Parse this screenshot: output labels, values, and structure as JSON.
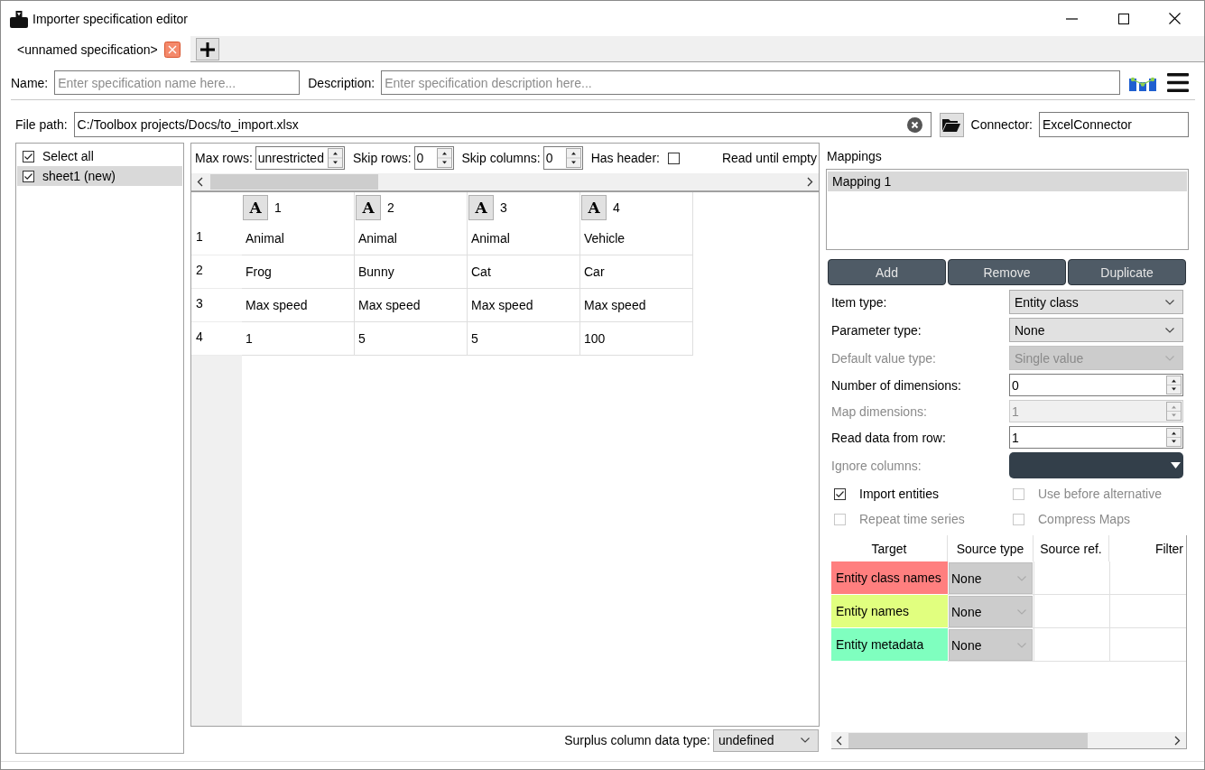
{
  "window": {
    "title": "Importer specification editor"
  },
  "tabs": [
    {
      "label": "<unnamed specification>",
      "selected": true
    }
  ],
  "name_field": {
    "label": "Name:",
    "placeholder": "Enter specification name here..."
  },
  "description_field": {
    "label": "Description:",
    "placeholder": "Enter specification description here..."
  },
  "file_path": {
    "label": "File path:",
    "value": "C:/Toolbox projects/Docs/to_import.xlsx"
  },
  "connector": {
    "label": "Connector:",
    "value": "ExcelConnector"
  },
  "sheets": [
    {
      "label": "Select all",
      "checked": true,
      "selected": false
    },
    {
      "label": "sheet1 (new)",
      "checked": true,
      "selected": true
    }
  ],
  "source_options": [
    {
      "kind": "spin",
      "label": "Max rows:",
      "value": "unrestricted"
    },
    {
      "kind": "spin",
      "label": "Skip rows:",
      "value": "0"
    },
    {
      "kind": "spin",
      "label": "Skip columns:",
      "value": "0"
    },
    {
      "kind": "check",
      "label": "Has header:",
      "checked": false
    },
    {
      "kind": "label",
      "label": "Read until empty"
    }
  ],
  "preview_table": {
    "columns": [
      {
        "type": "A",
        "label": "1"
      },
      {
        "type": "A",
        "label": "2"
      },
      {
        "type": "A",
        "label": "3"
      },
      {
        "type": "A",
        "label": "4"
      }
    ],
    "rows": [
      {
        "header": "1",
        "cells": [
          "Animal",
          "Animal",
          "Animal",
          "Vehicle"
        ]
      },
      {
        "header": "2",
        "cells": [
          "Frog",
          "Bunny",
          "Cat",
          "Car"
        ]
      },
      {
        "header": "3",
        "cells": [
          "Max speed",
          "Max speed",
          "Max speed",
          "Max speed"
        ]
      },
      {
        "header": "4",
        "cells": [
          "1",
          "5",
          "5",
          "100"
        ]
      }
    ]
  },
  "surplus_column_data_type": {
    "label": "Surplus column data type:",
    "value": "undefined"
  },
  "mappings": {
    "title": "Mappings",
    "items": [
      {
        "label": "Mapping 1",
        "selected": true
      }
    ],
    "buttons": [
      "Add",
      "Remove",
      "Duplicate"
    ]
  },
  "mapping_options": [
    {
      "kind": "combo",
      "label": "Item type:",
      "value": "Entity class",
      "disabled": false
    },
    {
      "kind": "combo",
      "label": "Parameter type:",
      "value": "None",
      "disabled": false
    },
    {
      "kind": "combo",
      "label": "Default value type:",
      "value": "Single value",
      "disabled": true
    },
    {
      "kind": "spin",
      "label": "Number of dimensions:",
      "value": "0",
      "disabled": false
    },
    {
      "kind": "spin",
      "label": "Map dimensions:",
      "value": "1",
      "disabled": true
    },
    {
      "kind": "spin",
      "label": "Read data from row:",
      "value": "1",
      "disabled": false
    },
    {
      "kind": "multi",
      "label": "Ignore columns:",
      "disabled": true
    }
  ],
  "mapping_checks": [
    {
      "label": "Import entities",
      "checked": true,
      "disabled": false
    },
    {
      "label": "Use before alternative",
      "checked": false,
      "disabled": true
    },
    {
      "label": "Repeat time series",
      "checked": false,
      "disabled": true
    },
    {
      "label": "Compress Maps",
      "checked": false,
      "disabled": true
    }
  ],
  "mapping_table": {
    "columns": [
      "Target",
      "Source type",
      "Source ref.",
      "Filter"
    ],
    "rows": [
      {
        "target": "Entity class names",
        "color": "#ff7f7f",
        "source_type": "None"
      },
      {
        "target": "Entity names",
        "color": "#e1ff7f",
        "source_type": "None"
      },
      {
        "target": "Entity metadata",
        "color": "#7fffbf",
        "source_type": "None"
      }
    ]
  }
}
